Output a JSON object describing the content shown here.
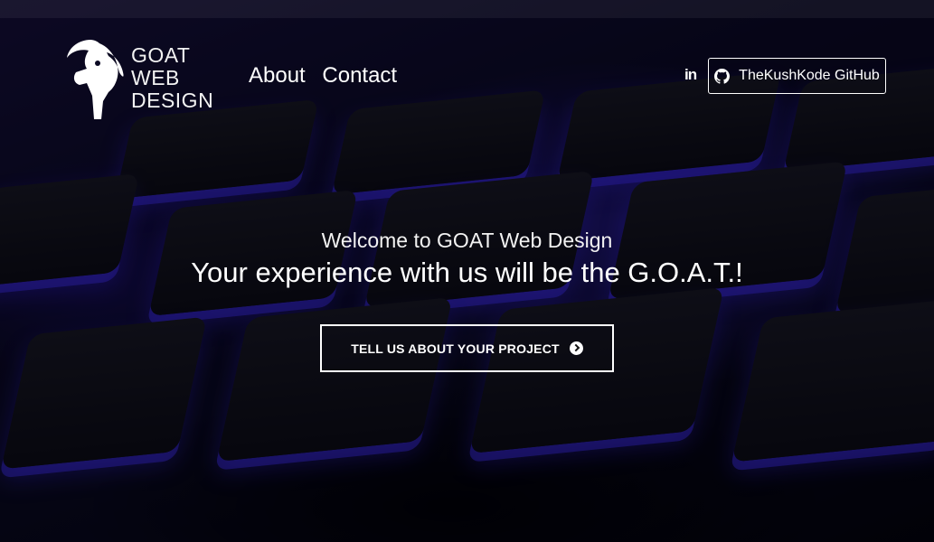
{
  "brand": {
    "logo_lines": [
      "GOAT",
      "WEB",
      "DESIGN"
    ],
    "logo_icon": "goat-head-icon"
  },
  "nav": {
    "items": [
      {
        "label": "About"
      },
      {
        "label": "Contact"
      }
    ]
  },
  "social": {
    "linkedin_label": "in",
    "github_label": "TheKushKode GitHub",
    "github_icon": "github-icon"
  },
  "hero": {
    "subtitle": "Welcome to GOAT Web Design",
    "title": "Your experience with us will be the G.O.A.T.!",
    "cta_label": "TELL US ABOUT YOUR PROJECT",
    "cta_icon": "chevron-circle-right-icon"
  },
  "colors": {
    "accent_glow": "#3c28dc",
    "text": "#ffffff"
  }
}
